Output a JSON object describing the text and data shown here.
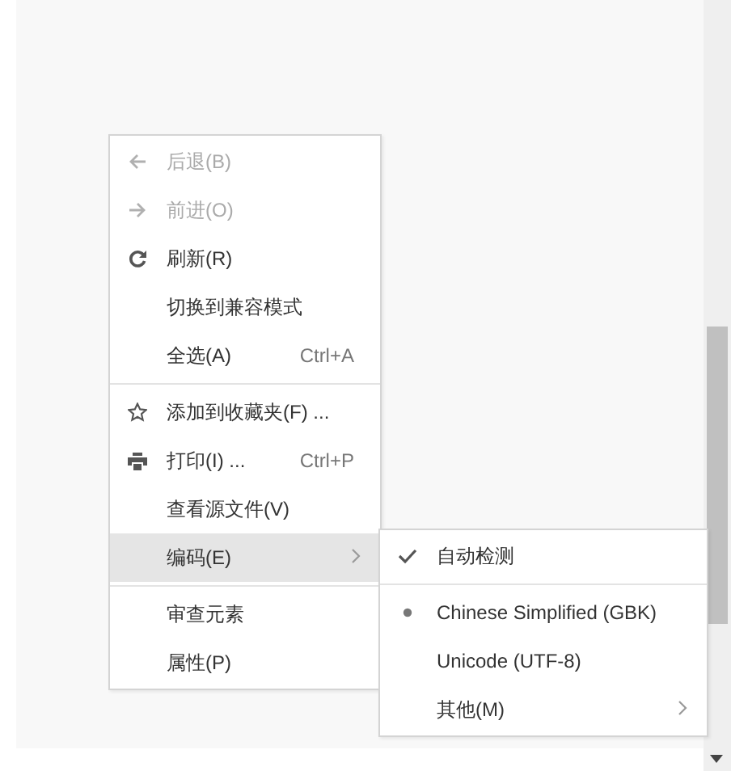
{
  "context_menu": {
    "items": [
      {
        "kind": "item",
        "label": "后退(B)",
        "disabled": true,
        "selected": false
      },
      {
        "kind": "item",
        "label": "前进(O)",
        "disabled": true,
        "selected": false
      },
      {
        "kind": "item",
        "label": "刷新(R)",
        "disabled": false,
        "selected": false
      },
      {
        "kind": "item",
        "label": "切换到兼容模式",
        "disabled": false,
        "selected": false
      },
      {
        "kind": "item",
        "label": "全选(A)",
        "shortcut": "Ctrl+A",
        "disabled": false,
        "selected": false
      },
      {
        "kind": "separator"
      },
      {
        "kind": "item",
        "label": "添加到收藏夹(F) ...",
        "disabled": false,
        "selected": false
      },
      {
        "kind": "item",
        "label": "打印(I) ...",
        "shortcut": "Ctrl+P",
        "disabled": false,
        "selected": false
      },
      {
        "kind": "item",
        "label": "查看源文件(V)",
        "disabled": false,
        "selected": false
      },
      {
        "kind": "submenu",
        "label": "编码(E)",
        "disabled": false,
        "selected": true
      },
      {
        "kind": "separator"
      },
      {
        "kind": "item",
        "label": "审查元素",
        "disabled": false,
        "selected": false
      },
      {
        "kind": "item",
        "label": "属性(P)",
        "disabled": false,
        "selected": false
      }
    ]
  },
  "encoding_submenu": {
    "items": [
      {
        "kind": "check",
        "label": "自动检测",
        "checked": true
      },
      {
        "kind": "separator"
      },
      {
        "kind": "radio",
        "label": "Chinese Simplified (GBK)",
        "selected": true
      },
      {
        "kind": "radio",
        "label": "Unicode (UTF-8)",
        "selected": false
      },
      {
        "kind": "submenu",
        "label": "其他(M)"
      }
    ]
  }
}
